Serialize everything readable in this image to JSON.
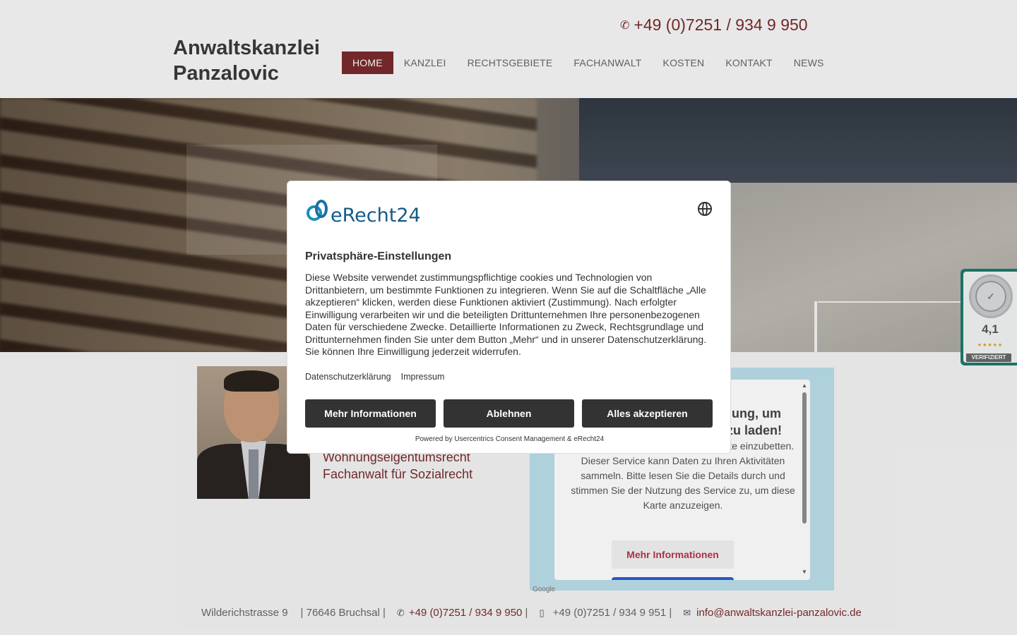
{
  "header": {
    "phone": "+49 (0)7251 / 934 9 950",
    "brand_line1": "Anwaltskanzlei",
    "brand_line2": "Panzalovic"
  },
  "nav": {
    "items": [
      {
        "label": "HOME",
        "active": true
      },
      {
        "label": "KANZLEI"
      },
      {
        "label": "RECHTSGEBIETE"
      },
      {
        "label": "FACHANWALT"
      },
      {
        "label": "KOSTEN"
      },
      {
        "label": "KONTAKT"
      },
      {
        "label": "NEWS"
      }
    ]
  },
  "lawyer": {
    "specialties": [
      "Wohnungseigentumsrecht",
      "Fachanwalt für Sozialrecht"
    ]
  },
  "map": {
    "title_line1": "nung, um",
    "title_line2": "zu laden!",
    "text": "eines Drittanbieters, um Karteninhalte einzubetten. Dieser Service kann Daten zu Ihren Aktivitäten sammeln. Bitte lesen Sie die Details durch und stimmen Sie der Nutzung des Service zu, um diese Karte anzuzeigen.",
    "more_button": "Mehr Informationen",
    "google": "Google"
  },
  "footer": {
    "street": "Wilderichstrasse 9",
    "city": "| 76646 Bruchsal |",
    "phone": "+49 (0)7251 / 934 9 950",
    "sep1": " |",
    "fax": "+49 (0)7251 / 934 9 951",
    "sep2": " |",
    "email": "info@anwaltskanzlei-panzalovic.de"
  },
  "badge": {
    "score": "4,1",
    "stars": "★★★★★",
    "verified": "VERIFIZIERT"
  },
  "consent": {
    "logo_text": "eRecht24",
    "title": "Privatsphäre-Einstellungen",
    "text": "Diese Website verwendet zustimmungspflichtige cookies und Technologien von Drittanbietern, um bestimmte Funktionen zu integrieren. Wenn Sie auf die Schaltfläche „Alle akzeptieren“ klicken, werden diese Funktionen aktiviert (Zustimmung). Nach erfolgter Einwilligung verarbeiten wir und die beteiligten Drittunternehmen Ihre personenbezogenen Daten für verschiedene Zwecke. Detaillierte Informationen zu Zweck, Rechtsgrundlage und Drittunternehmen finden Sie unter dem Button „Mehr“ und in unserer Datenschutzerklärung. Sie können Ihre Einwilligung jederzeit widerrufen.",
    "link_privacy": "Datenschutzerklärung",
    "link_imprint": "Impressum",
    "btn_more": "Mehr Informationen",
    "btn_decline": "Ablehnen",
    "btn_accept": "Alles akzeptieren",
    "powered": "Powered by Usercentrics Consent Management & eRecht24"
  },
  "colors": {
    "accent": "#7a2a2e",
    "button_dark": "#333333"
  }
}
